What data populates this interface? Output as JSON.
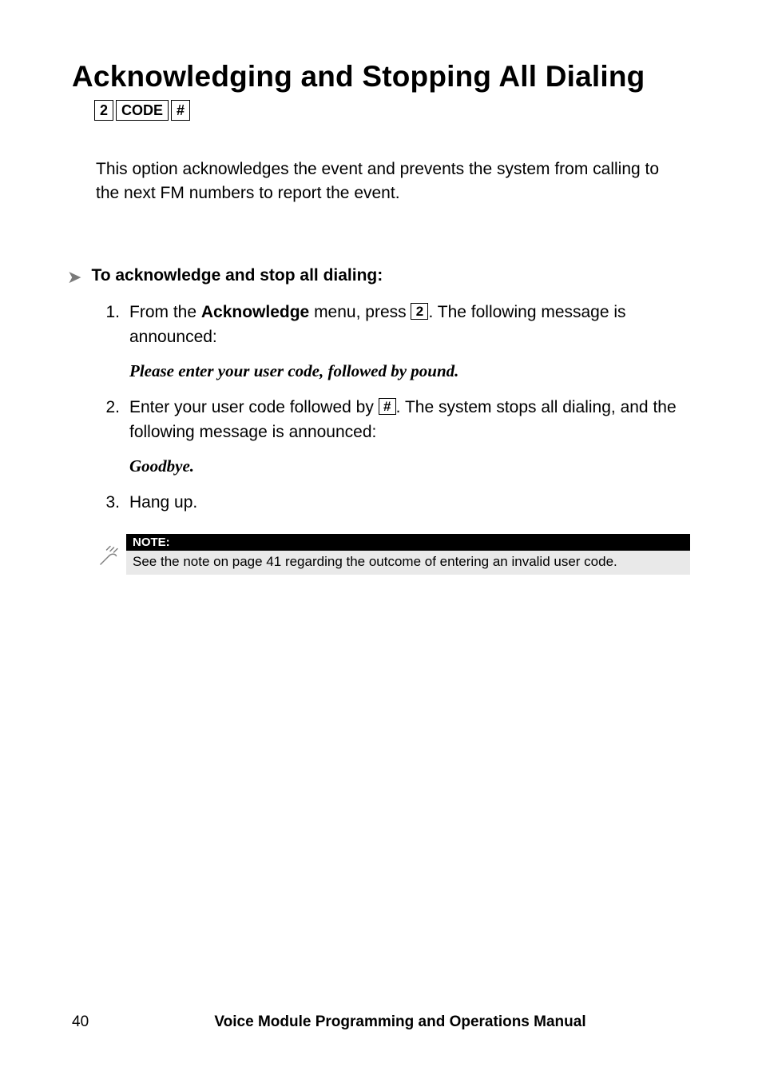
{
  "title": "Acknowledging and Stopping All Dialing",
  "titleKeys": {
    "k1": "2",
    "k2": "CODE",
    "k3": "#"
  },
  "intro": "This option acknowledges the event and prevents the system from calling to the next FM numbers to report the event.",
  "subheading": "To acknowledge and stop all dialing:",
  "steps": {
    "s1a": "From the ",
    "s1b": "Acknowledge",
    "s1c": " menu, press ",
    "s1key": "2",
    "s1d": ". The following message is announced:",
    "s1announce": "Please enter your user code, followed by pound.",
    "s2a": "Enter your user code followed by ",
    "s2key": "#",
    "s2b": ". The system stops all dialing, and the following message is announced:",
    "s2announce": "Goodbye.",
    "s3": "Hang up."
  },
  "note": {
    "label": "NOTE:",
    "body": "See the note on page 41 regarding the outcome of entering an invalid user code."
  },
  "footer": {
    "pageNumber": "40",
    "manualTitle": "Voice Module Programming and Operations Manual"
  }
}
